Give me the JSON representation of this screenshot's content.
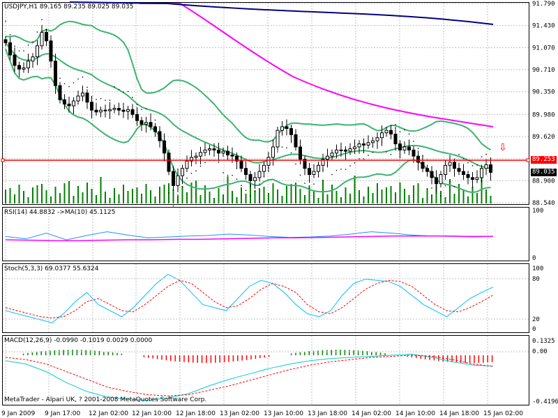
{
  "symbol_header": "USDJPY,H1  89.165 89.235 89.025 89.035",
  "rsi_header": "RSI(14) 44.8832  ->MA(10) 45.1125",
  "stoch_header": "Stoch(5,3,3) 69.0377 55.6324",
  "macd_header": "MACD(12,26,9) -0.0990 -0.1019 0.0029 0.0000",
  "copyright": "MetaTrader - Alpari UK, ? 2001-2008 MetaQuotes Software Corp.",
  "price_axis_labels": [
    "91.790",
    "91.430",
    "91.070",
    "90.710",
    "90.350",
    "89.980",
    "89.620",
    "89.260",
    "88.900",
    "88.540"
  ],
  "current_price_tag": "89.035",
  "alert_price_tag": "89.253",
  "rsi_axis_labels": [
    "100",
    "0"
  ],
  "stoch_axis_labels": [
    "100",
    "80",
    "20",
    "0"
  ],
  "macd_axis_labels": [
    "0.1325",
    "0.00",
    "-0.4196"
  ],
  "time_labels": [
    "9 Jan 2009",
    "9 Jan 17:00",
    "12 Jan 02:00",
    "12 Jan 10:00",
    "12 Jan 18:00",
    "13 Jan 02:00",
    "13 Jan 10:00",
    "13 Jan 18:00",
    "14 Jan 02:00",
    "14 Jan 10:00",
    "14 Jan 18:00",
    "15 Jan 02:00"
  ],
  "colors": {
    "background": "#ffffff",
    "grid": "#c0c0c0",
    "candle": "#000000",
    "bollinger": "#3cb371",
    "ma_magenta": "#ff00ff",
    "ma_blue": "#000080",
    "alert_line": "#ff0000",
    "volume": "#008000",
    "rsi": "#1e90ff",
    "rsi_ma": "#ff00ff",
    "stoch_main": "#00bfff",
    "stoch_signal": "#ff0000",
    "macd_main": "#00ced1",
    "macd_signal": "#ff0000",
    "macd_hist_pos": "#008000",
    "macd_hist_neg": "#ff0000"
  },
  "chart_data": {
    "type": "candlestick",
    "symbol": "USDJPY",
    "timeframe": "H1",
    "price_range": [
      88.54,
      91.79
    ],
    "closes": [
      91.15,
      90.95,
      90.78,
      90.72,
      90.74,
      90.85,
      90.92,
      91.1,
      91.32,
      91.18,
      90.85,
      90.45,
      90.22,
      90.15,
      90.12,
      90.2,
      90.28,
      90.33,
      90.18,
      90.05,
      90.02,
      90.05,
      90.04,
      90.06,
      90.08,
      90.05,
      90.03,
      90.06,
      89.98,
      89.88,
      89.82,
      89.85,
      89.78,
      89.7,
      89.55,
      89.35,
      89.05,
      88.82,
      88.98,
      89.1,
      89.22,
      89.28,
      89.3,
      89.36,
      89.4,
      89.42,
      89.4,
      89.35,
      89.38,
      89.32,
      89.3,
      89.22,
      89.1,
      89.0,
      88.9,
      88.95,
      89.05,
      89.15,
      89.28,
      89.45,
      89.72,
      89.78,
      89.75,
      89.65,
      89.45,
      89.25,
      89.1,
      89.0,
      89.05,
      89.15,
      89.25,
      89.3,
      89.35,
      89.4,
      89.4,
      89.38,
      89.42,
      89.45,
      89.5,
      89.48,
      89.52,
      89.55,
      89.6,
      89.68,
      89.72,
      89.66,
      89.5,
      89.4,
      89.45,
      89.4,
      89.3,
      89.2,
      89.1,
      89.05,
      88.95,
      88.85,
      89.0,
      89.15,
      89.2,
      89.1,
      89.05,
      89.0,
      88.95,
      88.92,
      88.95,
      89.1,
      89.16,
      89.035
    ],
    "rsi": {
      "range": [
        0,
        100
      ],
      "values_approx": [
        45,
        40,
        52,
        38,
        47,
        55,
        48,
        42,
        44,
        46,
        47,
        50,
        48,
        45,
        43,
        44,
        46,
        50,
        55,
        52,
        48,
        46,
        45,
        44,
        44.88
      ]
    },
    "rsi_ma": {
      "values_approx": [
        38,
        37,
        36,
        36,
        37,
        38,
        38,
        39,
        39,
        40,
        41,
        42,
        42,
        43,
        44,
        45,
        46,
        46,
        46,
        45,
        45.11
      ]
    },
    "stochastic": {
      "range": [
        0,
        100
      ],
      "levels": [
        20,
        80
      ],
      "main_approx": [
        30,
        25,
        20,
        15,
        10,
        25,
        45,
        60,
        40,
        30,
        20,
        35,
        55,
        75,
        90,
        80,
        60,
        40,
        35,
        30,
        50,
        70,
        80,
        75,
        60,
        40,
        25,
        20,
        30,
        55,
        75,
        82,
        80,
        78,
        70,
        55,
        40,
        30,
        20,
        35,
        50,
        60,
        69.04
      ],
      "signal_approx": [
        35,
        30,
        25,
        20,
        18,
        20,
        30,
        45,
        50,
        40,
        30,
        28,
        40,
        55,
        70,
        80,
        75,
        60,
        45,
        35,
        38,
        50,
        65,
        75,
        70,
        60,
        40,
        28,
        25,
        35,
        50,
        65,
        75,
        80,
        78,
        70,
        55,
        40,
        30,
        28,
        35,
        45,
        55.63
      ]
    },
    "macd": {
      "range": [
        -0.4196,
        0.1325
      ],
      "main": -0.099,
      "signal": -0.1019,
      "histogram": 0.0029
    }
  }
}
